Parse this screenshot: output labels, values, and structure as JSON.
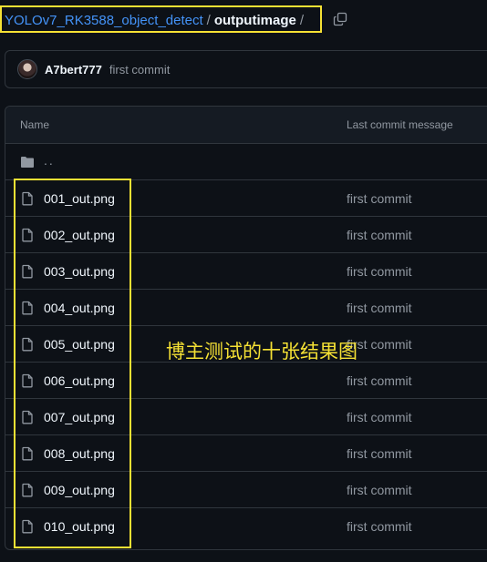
{
  "breadcrumb": {
    "repo": "YOLOv7_RK3588_object_detect",
    "separator": "/",
    "current": "outputimage",
    "trailing": "/"
  },
  "latest_commit": {
    "author": "A7bert777",
    "message": "first commit"
  },
  "table": {
    "headers": {
      "name": "Name",
      "last_commit": "Last commit message"
    },
    "parent": "..",
    "files": [
      {
        "name": "001_out.png",
        "commit": "first commit"
      },
      {
        "name": "002_out.png",
        "commit": "first commit"
      },
      {
        "name": "003_out.png",
        "commit": "first commit"
      },
      {
        "name": "004_out.png",
        "commit": "first commit"
      },
      {
        "name": "005_out.png",
        "commit": "first commit"
      },
      {
        "name": "006_out.png",
        "commit": "first commit"
      },
      {
        "name": "007_out.png",
        "commit": "first commit"
      },
      {
        "name": "008_out.png",
        "commit": "first commit"
      },
      {
        "name": "009_out.png",
        "commit": "first commit"
      },
      {
        "name": "010_out.png",
        "commit": "first commit"
      }
    ]
  },
  "annotation": "博主测试的十张结果图",
  "colors": {
    "highlight": "#f5e134",
    "link": "#4493f8",
    "background": "#0d1117"
  },
  "icons": {
    "copy": "copy-icon",
    "folder": "folder-icon",
    "file": "file-icon"
  }
}
